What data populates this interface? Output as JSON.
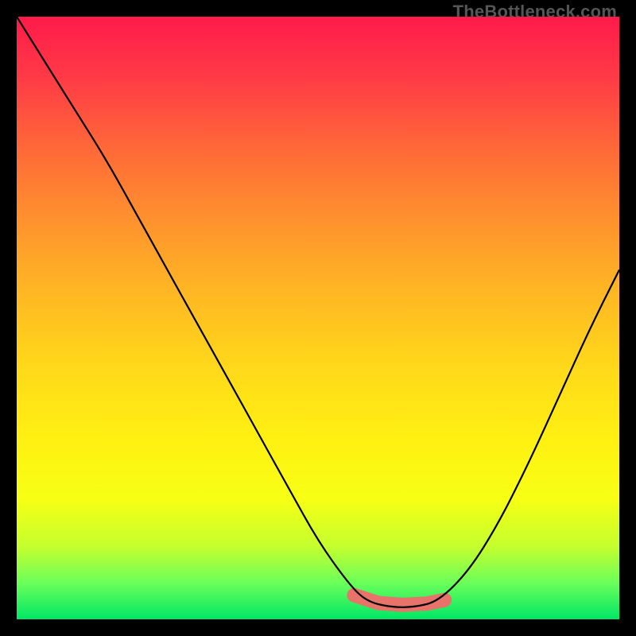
{
  "watermark": "TheBottleneck.com",
  "chart_data": {
    "type": "line",
    "title": "",
    "xlabel": "",
    "ylabel": "",
    "xlim": [
      0,
      100
    ],
    "ylim": [
      0,
      100
    ],
    "series": [
      {
        "name": "curve",
        "x": [
          0,
          5,
          10,
          15,
          20,
          25,
          30,
          35,
          40,
          45,
          50,
          55,
          58,
          62,
          66,
          70,
          75,
          80,
          85,
          90,
          95,
          100
        ],
        "y": [
          100,
          92,
          84,
          76,
          67,
          58,
          49,
          40,
          31,
          22,
          13,
          6,
          3,
          2,
          2,
          3,
          8,
          16,
          26,
          37,
          48,
          58
        ]
      }
    ],
    "highlight": {
      "name": "optimal-zone",
      "color": "#e8736b",
      "x": [
        56,
        60,
        64,
        68,
        71
      ],
      "y": [
        4,
        2.7,
        2.4,
        2.6,
        3.2
      ]
    },
    "background_gradient": {
      "top": "#ff1a4b",
      "bottom": "#00e765"
    }
  }
}
